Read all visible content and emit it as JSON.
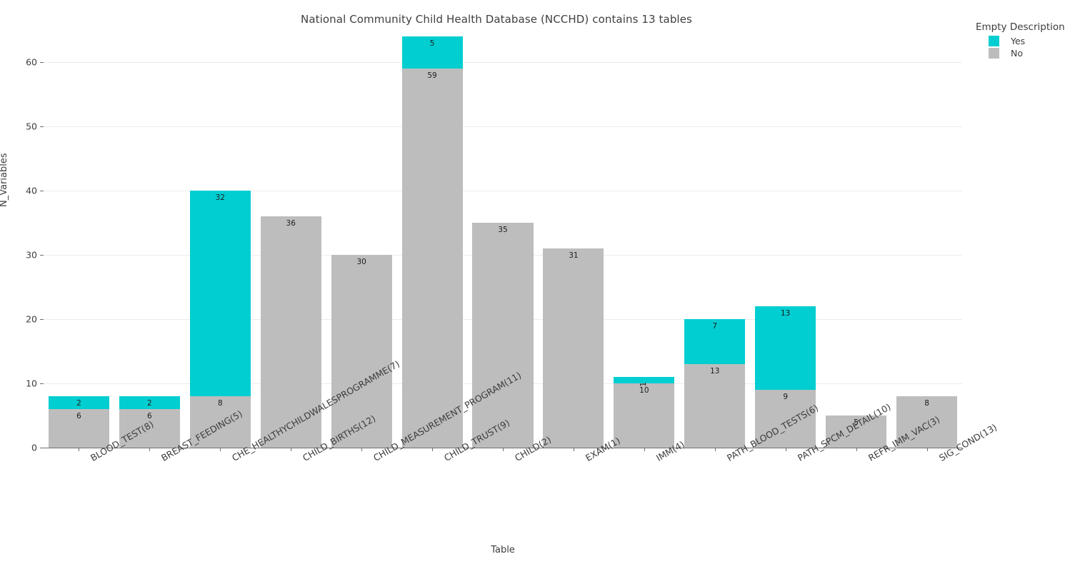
{
  "chart_data": {
    "type": "bar",
    "stacked": true,
    "title": "National Community Child Health Database (NCCHD) contains 13 tables",
    "xlabel": "Table",
    "ylabel": "N_Variables",
    "ylim": [
      0,
      65
    ],
    "yticks": [
      0,
      10,
      20,
      30,
      40,
      50,
      60
    ],
    "grid": "horizontal",
    "legend": {
      "title": "Empty Description",
      "position": "upper right outside",
      "entries": [
        {
          "label": "Yes",
          "color": "#00CED1"
        },
        {
          "label": "No",
          "color": "#BDBDBD"
        }
      ]
    },
    "categories": [
      "BLOOD_TEST(8)",
      "BREAST_FEEDING(5)",
      "CHE_HEALTHYCHILDWALESPROGRAMME(7)",
      "CHILD_BIRTHS(12)",
      "CHILD_MEASUREMENT_PROGRAM(11)",
      "CHILD_TRUST(9)",
      "CHILD(2)",
      "EXAM(1)",
      "IMM(4)",
      "PATH_BLOOD_TESTS(6)",
      "PATH_SPCM_DETAIL(10)",
      "REFR_IMM_VAC(3)",
      "SIG_COND(13)"
    ],
    "series": [
      {
        "name": "No",
        "color": "#BDBDBD",
        "values": [
          6,
          6,
          8,
          36,
          30,
          59,
          35,
          31,
          10,
          13,
          9,
          5,
          8
        ]
      },
      {
        "name": "Yes",
        "color": "#00CED1",
        "values": [
          2,
          2,
          32,
          0,
          0,
          5,
          0,
          0,
          1,
          7,
          13,
          0,
          0
        ]
      }
    ],
    "totals": [
      8,
      8,
      40,
      36,
      30,
      64,
      35,
      31,
      11,
      20,
      22,
      5,
      8
    ]
  }
}
